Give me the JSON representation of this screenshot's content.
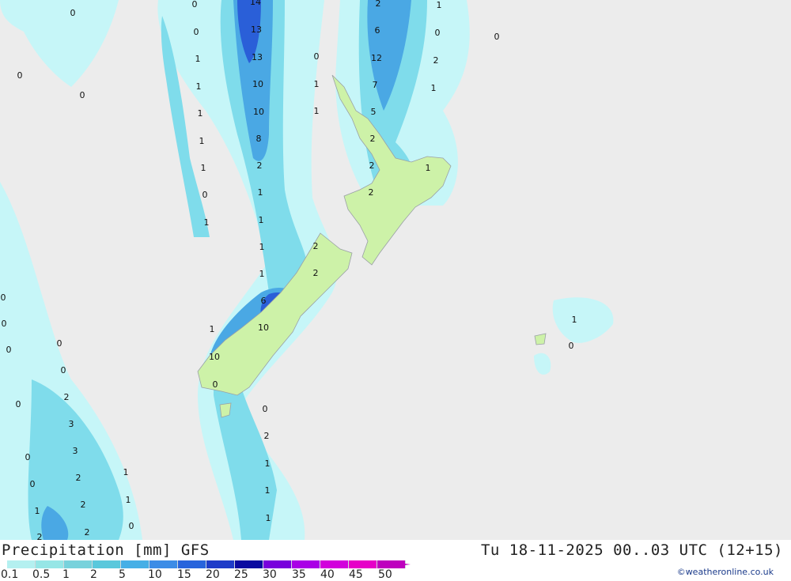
{
  "map": {
    "background_color": "#ececec",
    "value_labels": [
      {
        "text": "14"
      },
      {
        "text": "13"
      },
      {
        "text": "13"
      },
      {
        "text": "10"
      },
      {
        "text": "10"
      },
      {
        "text": "8"
      },
      {
        "text": "2"
      },
      {
        "text": "1"
      },
      {
        "text": "1"
      },
      {
        "text": "1"
      },
      {
        "text": "1"
      },
      {
        "text": "6"
      },
      {
        "text": "10"
      },
      {
        "text": "10"
      },
      {
        "text": "0"
      },
      {
        "text": "0"
      },
      {
        "text": "1"
      },
      {
        "text": "1"
      },
      {
        "text": "1"
      },
      {
        "text": "1"
      },
      {
        "text": "1"
      },
      {
        "text": "0"
      },
      {
        "text": "1"
      },
      {
        "text": "2"
      },
      {
        "text": "6"
      },
      {
        "text": "12"
      },
      {
        "text": "7"
      },
      {
        "text": "5"
      },
      {
        "text": "2"
      },
      {
        "text": "2"
      },
      {
        "text": "2"
      },
      {
        "text": "1"
      },
      {
        "text": "0"
      },
      {
        "text": "2"
      },
      {
        "text": "1"
      },
      {
        "text": "1"
      },
      {
        "text": "0"
      },
      {
        "text": "1"
      },
      {
        "text": "1"
      },
      {
        "text": "2"
      },
      {
        "text": "2"
      },
      {
        "text": "1"
      },
      {
        "text": "0"
      },
      {
        "text": "0"
      },
      {
        "text": "2"
      },
      {
        "text": "1"
      },
      {
        "text": "1"
      },
      {
        "text": "1"
      },
      {
        "text": "0"
      },
      {
        "text": "0"
      },
      {
        "text": "0"
      },
      {
        "text": "0"
      },
      {
        "text": "0"
      },
      {
        "text": "0"
      },
      {
        "text": "0"
      },
      {
        "text": "0"
      },
      {
        "text": "0"
      },
      {
        "text": "0"
      },
      {
        "text": "0"
      },
      {
        "text": "0"
      },
      {
        "text": "2"
      },
      {
        "text": "3"
      },
      {
        "text": "3"
      },
      {
        "text": "2"
      },
      {
        "text": "2"
      },
      {
        "text": "2"
      },
      {
        "text": "1"
      },
      {
        "text": "1"
      },
      {
        "text": "1"
      },
      {
        "text": "0"
      },
      {
        "text": "2"
      },
      {
        "text": "1"
      },
      {
        "text": "0"
      }
    ]
  },
  "footer": {
    "title": "Precipitation [mm] GFS",
    "valid_time": "Tu 18-11-2025 00..03 UTC (12+15)",
    "credit": "©weatheronline.co.uk",
    "scale": {
      "ticks": [
        "0.1",
        "0.5",
        "1",
        "2",
        "5",
        "10",
        "15",
        "20",
        "25",
        "30",
        "35",
        "40",
        "45",
        "50"
      ],
      "colors": [
        "#b4f0f0",
        "#96e6e6",
        "#78d2dc",
        "#5ac8dc",
        "#46afe6",
        "#3c8ce6",
        "#2864dc",
        "#1e3cc8",
        "#0a0aa0",
        "#7800dc",
        "#aa00e6",
        "#d200dc",
        "#e600c8",
        "#be00be"
      ]
    }
  }
}
